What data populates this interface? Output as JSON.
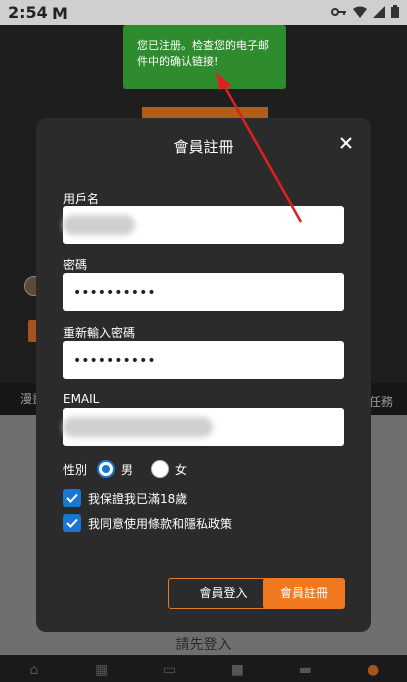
{
  "status_bar": {
    "time": "2:54",
    "app_icon": "M"
  },
  "toast": {
    "message": "您已注册。检查您的电子邮件中的确认链接!"
  },
  "background": {
    "tab_left": "漫畫",
    "tab_right": "任務",
    "login_prompt": "請先登入"
  },
  "modal": {
    "title": "會員註冊",
    "fields": {
      "username_label": "用戶名",
      "password_label": "密碼",
      "password_value": "••••••••••",
      "confirm_password_label": "重新輸入密碼",
      "confirm_password_value": "••••••••••",
      "email_label": "EMAIL"
    },
    "gender": {
      "label": "性別",
      "male": "男",
      "female": "女",
      "selected": "男"
    },
    "checks": {
      "age": "我保證我已滿18歲",
      "terms": "我同意使用條款和隱私政策"
    },
    "buttons": {
      "login": "會員登入",
      "register": "會員註冊"
    }
  },
  "colors": {
    "accent_orange": "#f0781f",
    "check_blue": "#1976d2",
    "toast_green": "#2e8b2e",
    "arrow_red": "#e02020"
  }
}
